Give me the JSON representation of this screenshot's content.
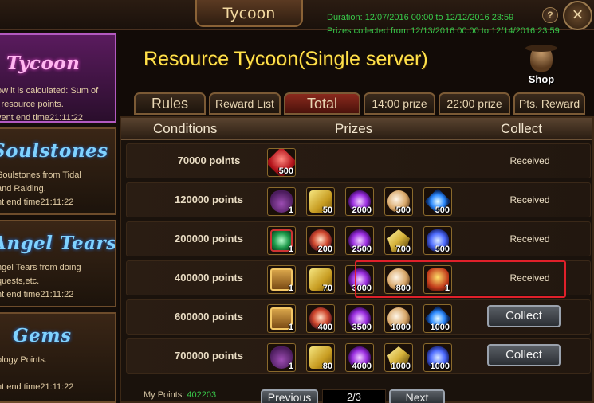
{
  "window": {
    "title": "Tycoon",
    "duration": "Duration: 12/07/2016 00:00 to 12/12/2016 23:59",
    "prizes_collected": "Prizes collected from 12/13/2016 00:00 to 12/14/2016 23:59",
    "help_glyph": "?",
    "close_glyph": "×"
  },
  "sidebar": {
    "items": [
      {
        "name": "Tycoon",
        "lines": [
          "ow it is calculated: Sum of",
          "l resource points.",
          "vent end time21:11:22"
        ]
      },
      {
        "name": "Soulstones",
        "lines": [
          "Soulstones from Tidal",
          "and Raiding.",
          "nt end time21:11:22"
        ]
      },
      {
        "name": "Angel Tears",
        "lines": [
          "ngel Tears from doing",
          "quests,etc.",
          "nt end time21:11:22"
        ]
      },
      {
        "name": "Gems",
        "lines": [
          "ology Points.",
          "",
          "nt end time21:11:22"
        ]
      }
    ]
  },
  "header": {
    "title": "Resource Tycoon(Single server)",
    "shop_label": "Shop"
  },
  "tabs": [
    "Rules",
    "Reward List",
    "Total",
    "14:00 prize",
    "22:00 prize",
    "Pts. Reward"
  ],
  "columns": [
    "Conditions",
    "Prizes",
    "Collect"
  ],
  "rows": [
    {
      "condition": "70000 points",
      "status": "Received",
      "items": [
        {
          "icon": "ruby-icon",
          "qty": "500"
        }
      ]
    },
    {
      "condition": "120000 points",
      "status": "Received",
      "items": [
        {
          "icon": "bag-icon",
          "qty": "1"
        },
        {
          "icon": "scroll-icon",
          "qty": "50"
        },
        {
          "icon": "purple-orb-icon",
          "qty": "2000"
        },
        {
          "icon": "pearl-orb-icon",
          "qty": "500"
        },
        {
          "icon": "blue-crystal-icon",
          "qty": "500"
        }
      ]
    },
    {
      "condition": "200000 points",
      "status": "Received",
      "items": [
        {
          "icon": "emerald-icon",
          "qty": "1"
        },
        {
          "icon": "red-orb-icon",
          "qty": "200"
        },
        {
          "icon": "purple-orb-icon",
          "qty": "2500"
        },
        {
          "icon": "wings-icon",
          "qty": "700"
        },
        {
          "icon": "blue-flower-icon",
          "qty": "500"
        }
      ]
    },
    {
      "condition": "400000 points",
      "status": "Received",
      "items": [
        {
          "icon": "chest-icon",
          "qty": "1"
        },
        {
          "icon": "scroll-icon",
          "qty": "70"
        },
        {
          "icon": "purple-orb-icon",
          "qty": "3000"
        },
        {
          "icon": "pearl-orb-icon",
          "qty": "800"
        },
        {
          "icon": "helm-icon",
          "qty": "1"
        }
      ]
    },
    {
      "condition": "600000 points",
      "status": "Collect",
      "items": [
        {
          "icon": "chest-icon",
          "qty": "1"
        },
        {
          "icon": "red-orb-icon",
          "qty": "400"
        },
        {
          "icon": "purple-orb-icon",
          "qty": "3500"
        },
        {
          "icon": "pearl-orb-icon",
          "qty": "1000"
        },
        {
          "icon": "blue-crystal-icon",
          "qty": "1000"
        }
      ]
    },
    {
      "condition": "700000 points",
      "status": "Collect",
      "items": [
        {
          "icon": "bag-icon",
          "qty": "1"
        },
        {
          "icon": "scroll-icon",
          "qty": "80"
        },
        {
          "icon": "purple-orb-icon",
          "qty": "4000"
        },
        {
          "icon": "wings-icon",
          "qty": "1000"
        },
        {
          "icon": "blue-flower-icon",
          "qty": "1000"
        }
      ]
    }
  ],
  "footer": {
    "my_points_label": "My Points:",
    "my_points_value": "402203",
    "previous": "Previous",
    "page": "2/3",
    "next": "Next"
  },
  "colors": {
    "accent_yellow": "#ffe14a",
    "green_text": "#38c84a",
    "highlight_red": "#e0202a"
  }
}
